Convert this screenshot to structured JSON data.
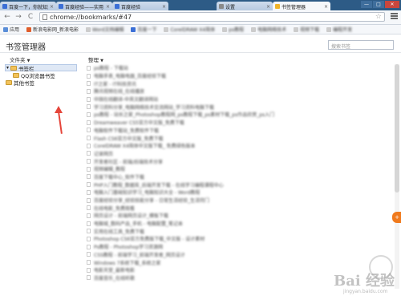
{
  "tabs": [
    {
      "title": "百度一下，你就知道",
      "color": "#3b6fd6",
      "active": false
    },
    {
      "title": "百度经验——实用",
      "color": "#3b6fd6",
      "active": false
    },
    {
      "title": "百度经验",
      "color": "#3b6fd6",
      "active": false
    },
    {
      "title": "设置",
      "color": "#8a8a8a",
      "active": false
    },
    {
      "title": "书签管理器",
      "color": "#f0b429",
      "active": true
    }
  ],
  "window": {
    "min": "—",
    "max": "□",
    "close": "✕"
  },
  "toolbar": {
    "back": "←",
    "forward": "→",
    "reload": "C",
    "url": "chrome://bookmarks/#47",
    "star": "☆"
  },
  "bookmarks_bar": [
    {
      "label": "应用",
      "color": "#5a8ed8",
      "blur": false
    },
    {
      "label": "新浪电影网_新浪电影",
      "color": "#e05d2b",
      "blur": false
    },
    {
      "label": "Word文档编辑",
      "color": "#cccccc",
      "blur": true
    },
    {
      "label": "百度一下",
      "color": "#3b6fd6",
      "blur": true
    },
    {
      "label": "CorelDRAW X4简体",
      "color": "#cccccc",
      "blur": true
    },
    {
      "label": "ps教程",
      "color": "#cccccc",
      "blur": true
    },
    {
      "label": "电脑网络技术",
      "color": "#cccccc",
      "blur": true
    },
    {
      "label": "视频下载",
      "color": "#cccccc",
      "blur": true
    },
    {
      "label": "编程开发",
      "color": "#cccccc",
      "blur": true
    }
  ],
  "page": {
    "title": "书签管理器",
    "search_placeholder": "搜索书签",
    "folders_header": "文件夹",
    "organize_header": "整理"
  },
  "tree": [
    {
      "label": "书签栏",
      "indent": 0,
      "selected": true
    },
    {
      "label": "QQ浏览器书签",
      "indent": 1,
      "selected": false
    },
    {
      "label": "其他书签",
      "indent": 0,
      "selected": false
    }
  ],
  "list_items": [
    "ps教程 - 下载站",
    "电脑手表_电脑电器_百度经验下载",
    "IT之家 - IT科技资讯",
    "腾讯视频在线_在线播放",
    "中国在线翻译-中英文翻译网站",
    "学习资料分享_电脑网络技术交流网站_学习资料电脑下载",
    "ps教程 - 站长之家_Photoshop教程网_ps教程下载_ps素材下载_ps作品欣赏_ps入门",
    "Dreamweaver CS5官方中文版_免费下载",
    "电脑软件下载站_免费软件下载",
    "Flash CS6官方中文版_免费下载",
    "CorelDRAW X4简体中文版下载_ 免费绿色版本",
    "记录网页",
    "开发者社区 - 前端/后端技术分享",
    "视频编辑_教程",
    "百度下载中心_软件下载",
    "PHP入门教程_数据库_后端开发下载 - 在线学习编程课程中心",
    "电脑入门基础知识学习_电脑知识大全 - Word教程",
    "百度经验分享_经验技能分享 - 日常生活经验_生活窍门",
    "在线电影_免费观看",
    "网页设计 - 前端网页设计_模板下载",
    "电脑城_数码产品_手机 - 电脑配置_笔记本",
    "实用在线工具_免费下载",
    "Photoshop CS6官方免费版下载_中文版 - 设计素材",
    "Ps教程 - Photoshop学习资源网",
    "CSS教程 - 前端学习_前端开发者_网页设计",
    "Windows 7系统下载_系统之家",
    "电影天堂_最新电影",
    "百度音乐_在线听歌"
  ],
  "watermark": {
    "logo": "Bai 经验",
    "sub": "jingyan.baidu.com"
  },
  "float_button": "+"
}
